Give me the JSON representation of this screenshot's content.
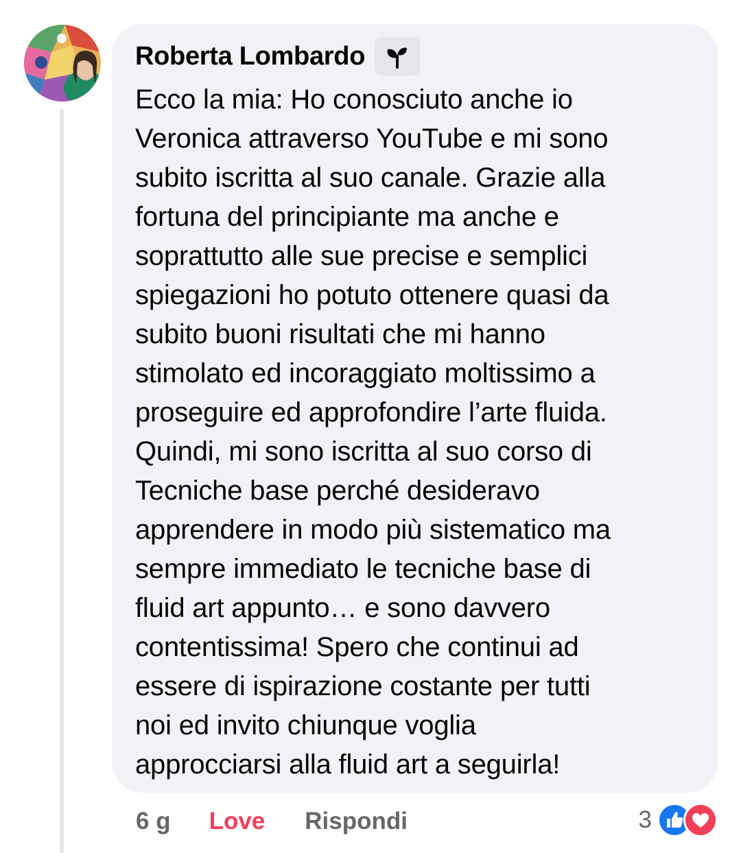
{
  "comment": {
    "author": "Roberta Lombardo",
    "badge_icon": "sprout-icon",
    "text": "Ecco la mia: Ho conosciuto anche io\nVeronica attraverso YouTube e mi sono\nsubito iscritta al suo canale. Grazie alla\nfortuna del principiante ma anche e\nsoprattutto alle sue precise e semplici\nspiegazioni ho potuto ottenere quasi da\nsubito buoni risultati che mi hanno\nstimolato ed incoraggiato moltissimo a\nproseguire ed approfondire l’arte fluida.\nQuindi, mi sono iscritta al suo corso di\nTecniche base perché desideravo\napprendere in modo più sistematico ma\nsempre immediato le tecniche base di\nfluid art appunto… e sono davvero\ncontentissima! Spero che continui ad\nessere di ispirazione costante per tutti\nnoi ed invito chiunque voglia\napprocciarsi alla fluid art a seguirla!",
    "time": "6 g",
    "reaction_label": "Love",
    "reply_label": "Rispondi",
    "reaction_count": "3",
    "reaction_icons": [
      "like-icon",
      "love-icon"
    ]
  },
  "colors": {
    "bubble": "#f0f2f5",
    "love": "#f33e58",
    "like_blue": "#1877f2",
    "muted": "#65676b"
  }
}
